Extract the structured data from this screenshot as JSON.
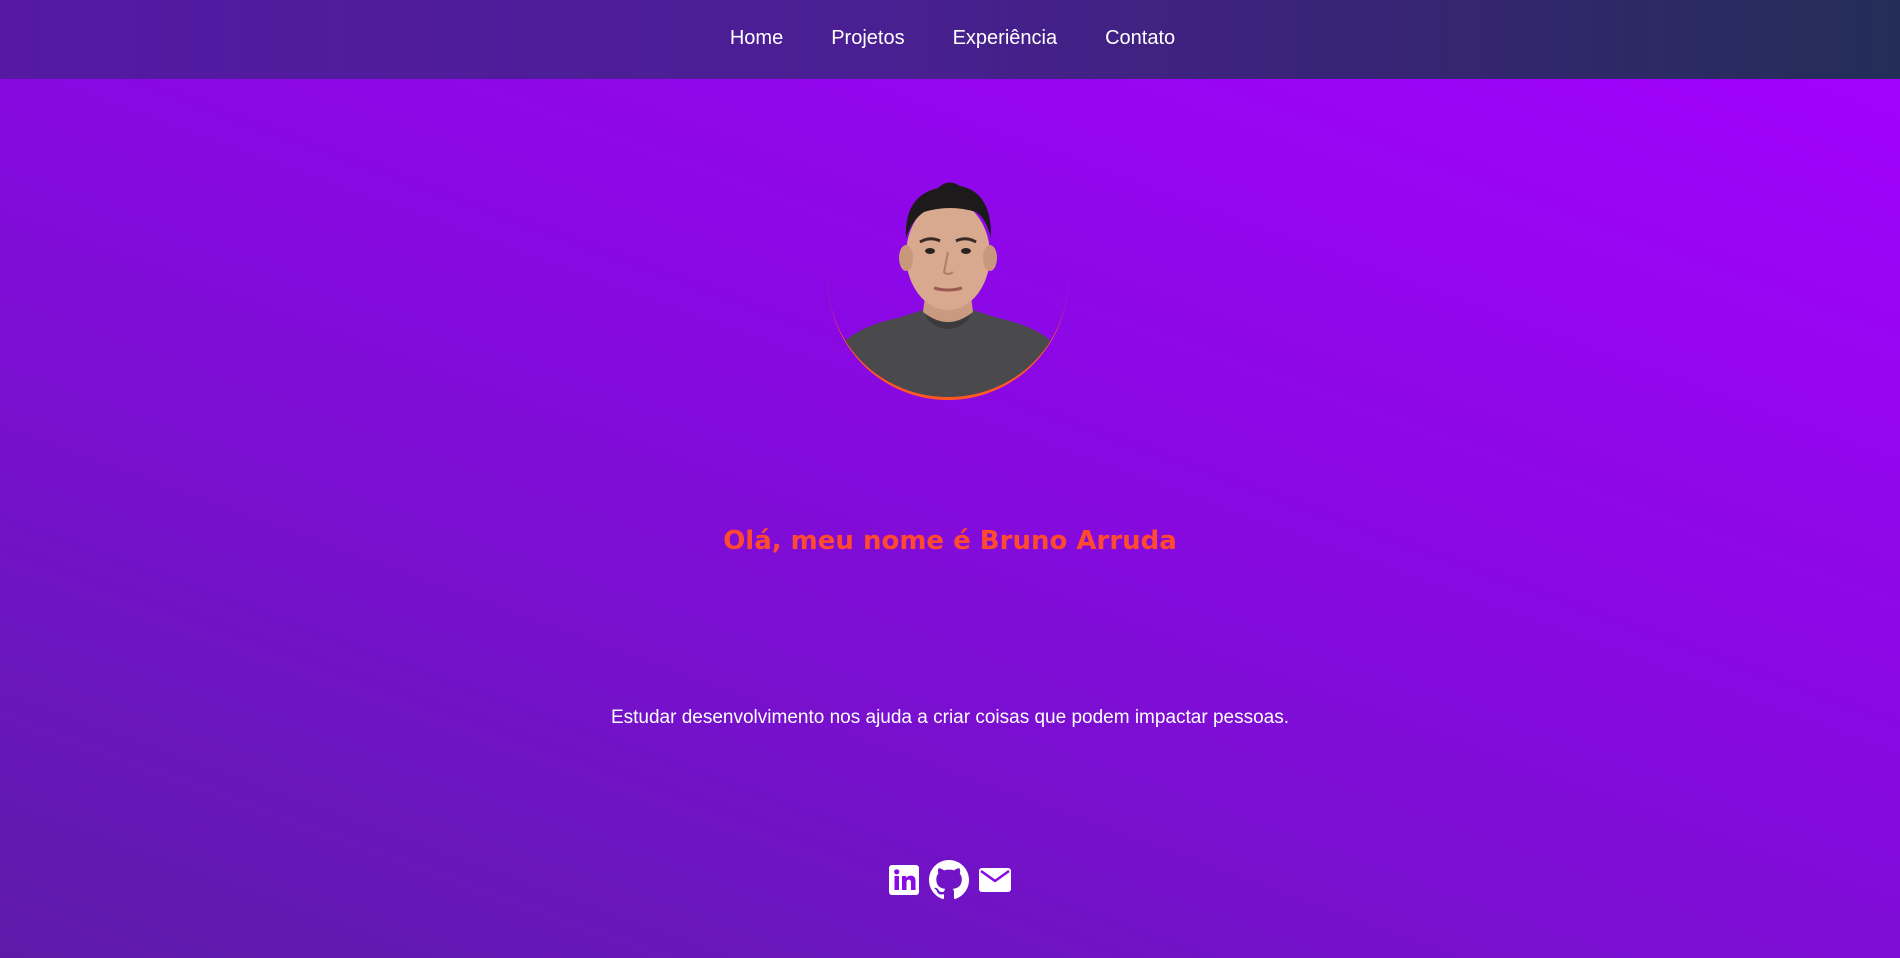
{
  "nav": {
    "items": [
      {
        "label": "Home"
      },
      {
        "label": "Projetos"
      },
      {
        "label": "Experiência"
      },
      {
        "label": "Contato"
      }
    ]
  },
  "hero": {
    "title": "Olá, meu nome é Bruno Arruda",
    "subtitle": "Estudar desenvolvimento nos ajuda a criar coisas que podem impactar pessoas."
  },
  "social": {
    "icons": [
      "linkedin-icon",
      "github-icon",
      "email-icon"
    ]
  },
  "colors": {
    "accent": "#ff4a2f",
    "background_top": "#a300ff",
    "background_bottom": "#5d1aa8",
    "header": "#4a1f93"
  }
}
